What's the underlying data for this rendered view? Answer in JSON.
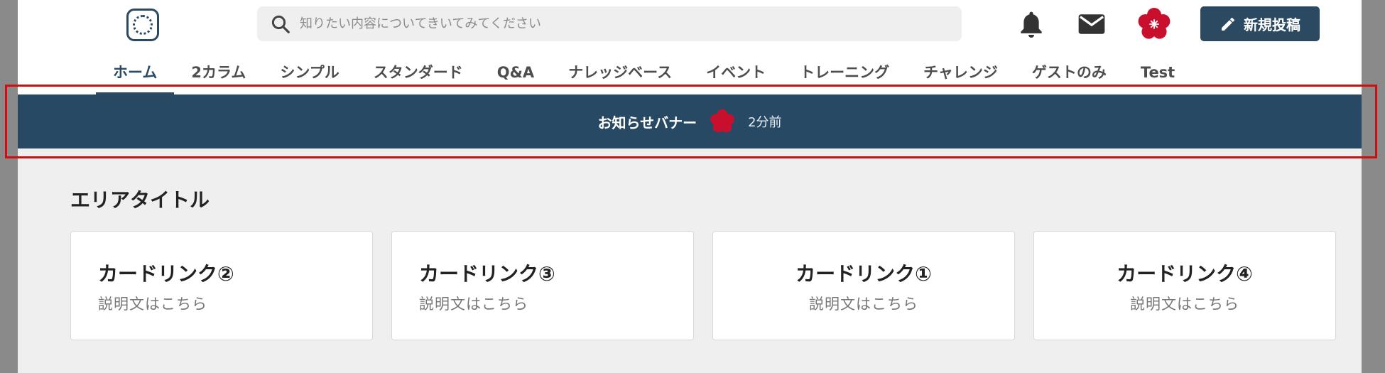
{
  "search": {
    "placeholder": "知りたい内容についてきいてみてください"
  },
  "header": {
    "post_button_label": "新規投稿"
  },
  "tabs": [
    {
      "label": "ホーム"
    },
    {
      "label": "2カラム"
    },
    {
      "label": "シンプル"
    },
    {
      "label": "スタンダード"
    },
    {
      "label": "Q&A"
    },
    {
      "label": "ナレッジベース"
    },
    {
      "label": "イベント"
    },
    {
      "label": "トレーニング"
    },
    {
      "label": "チャレンジ"
    },
    {
      "label": "ゲストのみ"
    },
    {
      "label": "Test"
    }
  ],
  "banner": {
    "text": "お知らせバナー",
    "time": "2分前"
  },
  "area": {
    "title": "エリアタイトル",
    "cards": [
      {
        "title": "カードリンク②",
        "description": "説明文はこちら"
      },
      {
        "title": "カードリンク③",
        "description": "説明文はこちら"
      },
      {
        "title": "カードリンク①",
        "description": "説明文はこちら"
      },
      {
        "title": "カードリンク④",
        "description": "説明文はこちら"
      }
    ]
  },
  "colors": {
    "primary": "#2b4a62",
    "banner": "#284963",
    "accent_red": "#c8102e",
    "highlight": "#d10d0d"
  },
  "icons": [
    "logo-icon",
    "search-icon",
    "bell-icon",
    "mail-icon",
    "avatar-flower-icon",
    "pencil-icon",
    "flower-icon"
  ]
}
